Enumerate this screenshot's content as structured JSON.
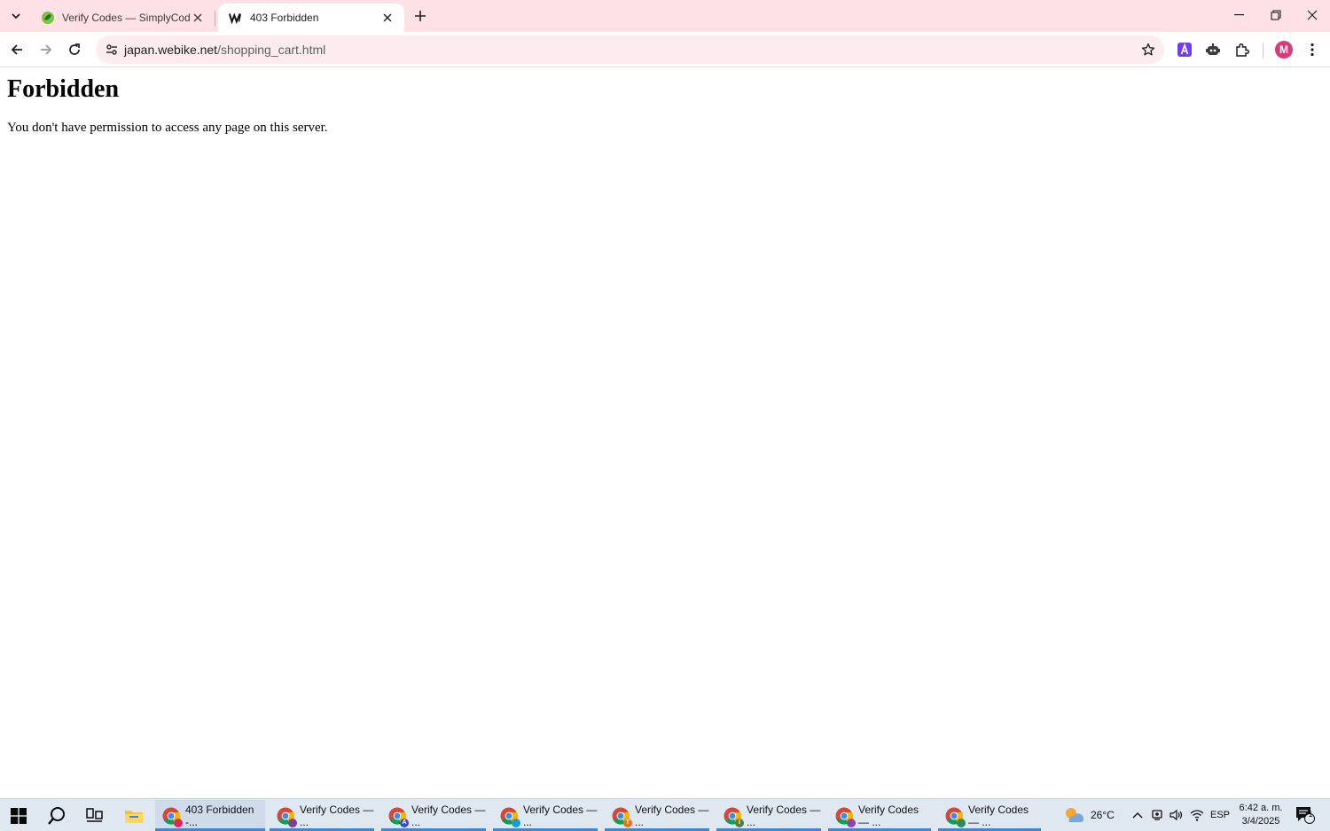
{
  "browser": {
    "tabs": [
      {
        "title": "Verify Codes — SimplyCodes",
        "active": false,
        "favicon": "simplycodes-leaf-icon"
      },
      {
        "title": "403 Forbidden",
        "active": true,
        "favicon": "webike-w-icon"
      }
    ],
    "url_host": "japan.webike.net",
    "url_path": "/shopping_cart.html",
    "profile_initial": "M",
    "accent_color": "#fde1e6"
  },
  "page": {
    "heading": "Forbidden",
    "message": "You don't have permission to access any page on this server."
  },
  "taskbar": {
    "apps": [
      {
        "label": "403 Forbidden -...",
        "badge": "",
        "badge_color": "#e0245e",
        "active": true
      },
      {
        "label": "Verify Codes — ...",
        "badge": "",
        "badge_color": "#7b3fa0",
        "active": false
      },
      {
        "label": "Verify Codes — ...",
        "badge": "A",
        "badge_color": "#3b4bd8",
        "active": false
      },
      {
        "label": "Verify Codes — ...",
        "badge": "",
        "badge_color": "#1d9bd1",
        "active": false
      },
      {
        "label": "Verify Codes — ...",
        "badge": "T",
        "badge_color": "#e8711a",
        "active": false
      },
      {
        "label": "Verify Codes — ...",
        "badge": "I",
        "badge_color": "#5a7a3a",
        "active": false
      },
      {
        "label": "Verify Codes — ...",
        "badge": "",
        "badge_color": "#8e44ad",
        "active": false
      },
      {
        "label": "Verify Codes — ...",
        "badge": "",
        "badge_color": "#2e8b57",
        "active": false
      }
    ],
    "weather": "26°C",
    "language": "ESP",
    "time": "6:42 a. m.",
    "date": "3/4/2025",
    "notification_count": "1"
  }
}
